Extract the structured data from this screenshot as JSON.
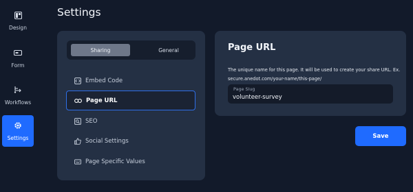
{
  "rail": {
    "items": [
      {
        "label": "Design",
        "icon": "design-icon"
      },
      {
        "label": "Form",
        "icon": "form-icon"
      },
      {
        "label": "Workflows",
        "icon": "workflows-icon"
      },
      {
        "label": "Settings",
        "icon": "gear-icon",
        "active": true
      }
    ]
  },
  "page": {
    "title": "Settings"
  },
  "tabs": {
    "sharing": "Sharing",
    "general": "General",
    "active": "Sharing"
  },
  "nav": {
    "items": [
      {
        "label": "Embed Code",
        "icon": "embed-icon"
      },
      {
        "label": "Page URL",
        "icon": "link-icon",
        "active": true
      },
      {
        "label": "SEO",
        "icon": "seo-icon"
      },
      {
        "label": "Social Settings",
        "icon": "thumbs-up-icon"
      },
      {
        "label": "Page Specific Values",
        "icon": "keyboard-icon"
      }
    ]
  },
  "url_card": {
    "title": "Page URL",
    "description": "The unique name for this page. It will be used to create your share URL. Ex. secure.anedot.com/your-name/this-page/",
    "slug_label": "Page Slug",
    "slug_value": "volunteer-survey"
  },
  "actions": {
    "save_label": "Save"
  },
  "colors": {
    "accent": "#1f6bff",
    "background": "#121a2a",
    "card": "#243044"
  }
}
